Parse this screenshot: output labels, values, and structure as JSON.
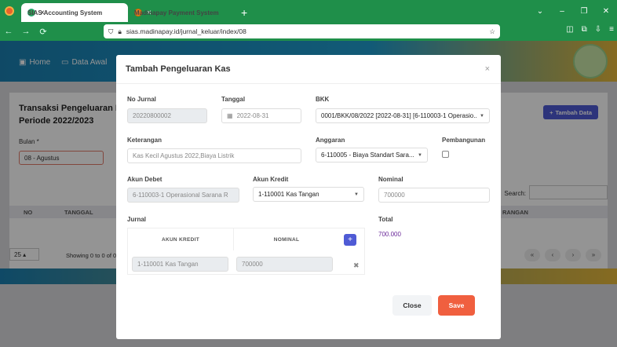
{
  "browser": {
    "tabs": [
      {
        "label": "SIAS Accounting System",
        "close": "×"
      },
      {
        "label": "Madinapay Payment System",
        "close": "×"
      }
    ],
    "new_tab": "+",
    "url": "sias.madinapay.id/jurnal_keluar/index/08",
    "controls": {
      "dropdown": "⌄",
      "minimize": "–",
      "restore": "❐",
      "close": "✕"
    }
  },
  "app_menu": {
    "home": "Home",
    "data_awal": "Data Awal"
  },
  "background_page": {
    "title_line1": "Transaksi Pengeluaran K",
    "title_line2": "Periode 2022/2023",
    "bulan_label": "Bulan *",
    "bulan_value": "08 - Agustus",
    "add_button": "Tambah Data",
    "search_label": "Search:",
    "table_headers": {
      "no": "NO",
      "tanggal": "TANGGAL",
      "keterangan": "RANGAN"
    },
    "page_length": "25",
    "showing": "Showing 0 to 0 of 0",
    "pager": [
      "«",
      "‹",
      "›",
      "»"
    ]
  },
  "modal": {
    "title": "Tambah Pengeluaran Kas",
    "close_icon": "×",
    "fields": {
      "no_jurnal": {
        "label": "No Jurnal",
        "value": "20220800002"
      },
      "tanggal": {
        "label": "Tanggal",
        "value": "2022-08-31"
      },
      "bkk": {
        "label": "BKK",
        "value": "0001/BKK/08/2022 [2022-08-31] [6-110003-1 Operasio..."
      },
      "keterangan": {
        "label": "Keterangan",
        "value": "Kas Kecil Agustus 2022,Biaya Listrik"
      },
      "anggaran": {
        "label": "Anggaran",
        "value": "6-110005 - Biaya Standart Sara..."
      },
      "pembangunan": {
        "label": "Pembangunan",
        "checked": false
      },
      "akun_debet": {
        "label": "Akun Debet",
        "value": "6-110003-1 Operasional Sarana R"
      },
      "akun_kredit": {
        "label": "Akun Kredit",
        "value": "1-110001 Kas Tangan"
      },
      "nominal": {
        "label": "Nominal",
        "placeholder": "700000"
      }
    },
    "jurnal": {
      "label": "Jurnal",
      "headers": {
        "akun_kredit": "AKUN KREDIT",
        "nominal": "NOMINAL"
      },
      "add_icon": "+",
      "rows": [
        {
          "akun_kredit": "1-110001 Kas Tangan",
          "nominal": "700000",
          "delete_icon": "✖"
        }
      ]
    },
    "total": {
      "label": "Total",
      "value": "700.000"
    },
    "buttons": {
      "close": "Close",
      "save": "Save"
    }
  }
}
